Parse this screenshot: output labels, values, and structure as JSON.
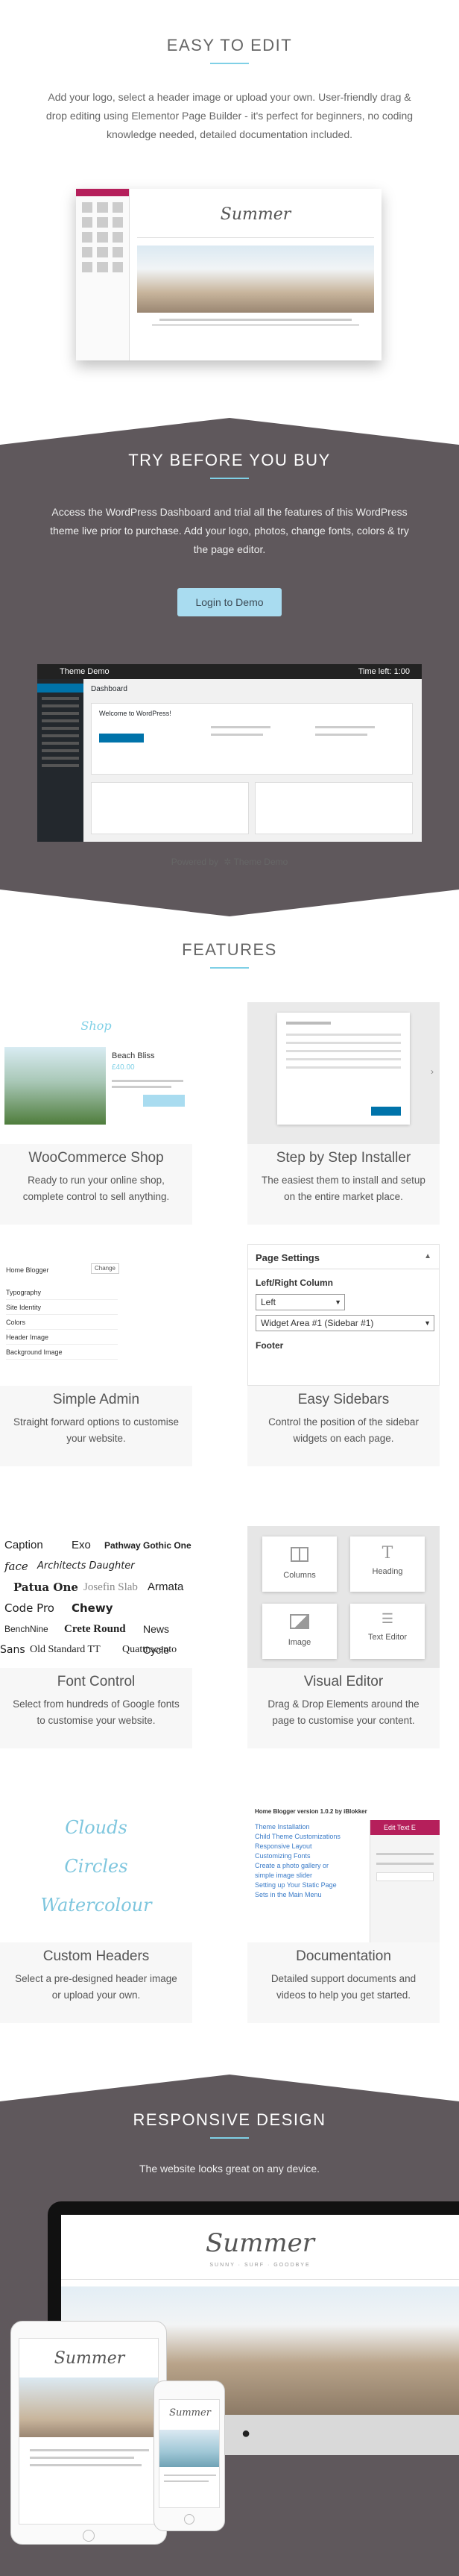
{
  "easy": {
    "title": "EASY TO EDIT",
    "text": "Add your logo, select a header image or upload your own. User-friendly drag & drop editing using Elementor Page Builder - it's perfect for beginners, no coding knowledge needed, detailed documentation included."
  },
  "try": {
    "title": "TRY BEFORE YOU BUY",
    "text": "Access the WordPress Dashboard and trial all the features of this WordPress theme live prior to purchase. Add your logo, photos, change fonts, colors & try the page editor.",
    "button": "Login to Demo",
    "demo_bar_title": "Theme Demo",
    "demo_time": "Time left: 1:00",
    "dashboard_title": "Dashboard",
    "welcome": "Welcome to WordPress!",
    "powered_by": "Powered by",
    "powered_brand": "Theme Demo"
  },
  "features": {
    "title": "FEATURES",
    "items": [
      {
        "title": "WooCommerce Shop",
        "desc": "Ready to run your online shop, complete control to sell anything.",
        "shop_label": "Shop",
        "product": "Beach Bliss",
        "price": "£40.00"
      },
      {
        "title": "Step by Step Installer",
        "desc": "The easiest them to install and setup on the entire market place."
      },
      {
        "title": "Simple Admin",
        "desc": "Straight forward options to customise your website.",
        "menu": [
          "Typography",
          "Site Identity",
          "Colors",
          "Header Image",
          "Background Image"
        ],
        "change": "Change",
        "active": "Home Blogger"
      },
      {
        "title": "Easy Sidebars",
        "desc": "Control the position of the sidebar widgets on each page.",
        "panel_title": "Page Settings",
        "col_label": "Left/Right Column",
        "opt1": "Left",
        "opt2": "Widget Area #1 (Sidebar #1)",
        "footer": "Footer"
      },
      {
        "title": "Font Control",
        "desc": "Select from hundreds of Google fonts to customise your website.",
        "fonts": [
          "Caption",
          "Exo",
          "Pathway Gothic One",
          "face",
          "Architects Daughter",
          "Patua One",
          "Josefin Slab",
          "Armata",
          "Code Pro",
          "Chewy",
          "BenchNine",
          "Crete Round",
          "News Cycle",
          "Sans",
          "Old Standard TT",
          "Quattrocento"
        ]
      },
      {
        "title": "Visual Editor",
        "desc": "Drag & Drop Elements around the page to customise your content.",
        "widgets": [
          "Columns",
          "Heading",
          "Image",
          "Text Editor"
        ]
      },
      {
        "title": "Custom Headers",
        "desc": "Select a pre-designed header image or upload your own.",
        "words": [
          "Clouds",
          "Circles",
          "Watercolour"
        ]
      },
      {
        "title": "Documentation",
        "desc": "Detailed support documents and videos to help you get started.",
        "doc_head": "Home Blogger version 1.0.2 by iBlokker",
        "editor": "Edit Text E",
        "links": [
          "Theme Installation",
          "Child Theme Customizations",
          "Responsive Layout",
          "Customizing Fonts",
          "Create a photo gallery or",
          "simple image slider",
          "Setting up Your Static Page",
          "Sets in the Main Menu"
        ]
      }
    ]
  },
  "responsive": {
    "title": "RESPONSIVE DESIGN",
    "text": "The website looks great on any device.",
    "brand": "Summer",
    "tagline": "SUNNY · SURF · GOODBYE"
  },
  "colors": {
    "accent": "#7fd0e6",
    "dark": "#5f585c",
    "button": "#a9dcf0"
  }
}
